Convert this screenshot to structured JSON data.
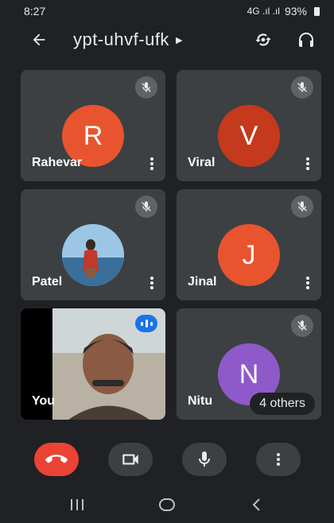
{
  "status_bar": {
    "time": "8:27",
    "network": "4G .ıl .ıl",
    "battery": "93%"
  },
  "top_bar": {
    "meeting_code": "ypt-uhvf-ufk",
    "icons": [
      "back-arrow-icon",
      "switch-camera-icon",
      "audio-output-icon"
    ]
  },
  "participants": [
    {
      "name": "Rahevar",
      "initial": "R",
      "color": "#e8542e",
      "muted": true
    },
    {
      "name": "Viral",
      "initial": "V",
      "color": "#c5391d",
      "muted": true
    },
    {
      "name": "Patel",
      "initial": "",
      "color": "#7fb1d9",
      "muted": true,
      "photo": true
    },
    {
      "name": "Jinal",
      "initial": "J",
      "color": "#e8542e",
      "muted": true
    },
    {
      "name": "You",
      "initial": "",
      "color": "#000000",
      "muted": false,
      "video": true
    },
    {
      "name": "Nitu",
      "initial": "N",
      "color": "#8e5ac9",
      "muted": true
    }
  ],
  "others_label": "4 others",
  "controls": [
    "end-call",
    "camera",
    "microphone",
    "more-options"
  ],
  "colors": {
    "background": "#202124",
    "tile": "#3c4043",
    "end_call": "#ea4335",
    "speaking": "#1a73e8"
  }
}
